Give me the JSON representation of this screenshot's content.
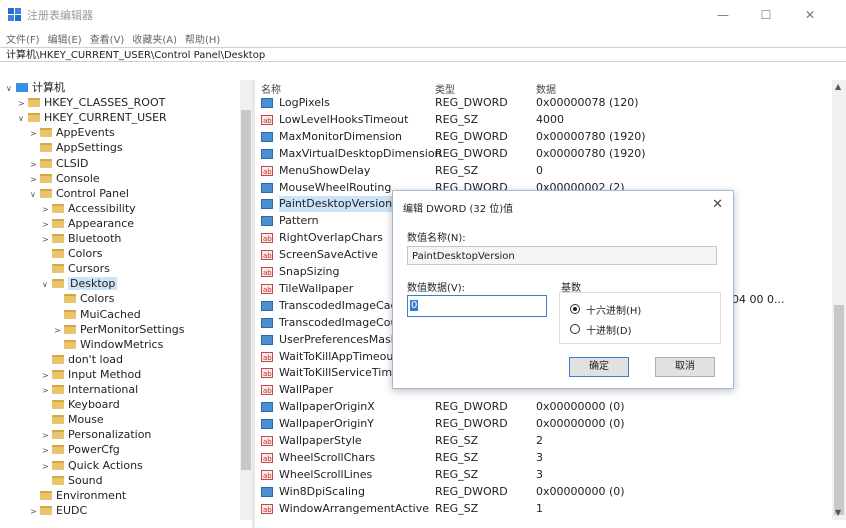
{
  "window": {
    "title": "注册表编辑器",
    "minimize": "—",
    "maximize": "☐",
    "close": "✕"
  },
  "menu": [
    "文件(F)",
    "编辑(E)",
    "查看(V)",
    "收藏夹(A)",
    "帮助(H)"
  ],
  "address": "计算机\\HKEY_CURRENT_USER\\Control Panel\\Desktop",
  "tree": [
    {
      "label": "计算机",
      "indent": 0,
      "chev": "∨",
      "icon": "pc"
    },
    {
      "label": "HKEY_CLASSES_ROOT",
      "indent": 1,
      "chev": ">"
    },
    {
      "label": "HKEY_CURRENT_USER",
      "indent": 1,
      "chev": "∨"
    },
    {
      "label": "AppEvents",
      "indent": 2,
      "chev": ">"
    },
    {
      "label": "AppSettings",
      "indent": 2,
      "chev": ""
    },
    {
      "label": "CLSID",
      "indent": 2,
      "chev": ">"
    },
    {
      "label": "Console",
      "indent": 2,
      "chev": ">"
    },
    {
      "label": "Control Panel",
      "indent": 2,
      "chev": "∨"
    },
    {
      "label": "Accessibility",
      "indent": 3,
      "chev": ">"
    },
    {
      "label": "Appearance",
      "indent": 3,
      "chev": ">"
    },
    {
      "label": "Bluetooth",
      "indent": 3,
      "chev": ">"
    },
    {
      "label": "Colors",
      "indent": 3,
      "chev": ""
    },
    {
      "label": "Cursors",
      "indent": 3,
      "chev": ""
    },
    {
      "label": "Desktop",
      "indent": 3,
      "chev": "∨",
      "selected": true
    },
    {
      "label": "Colors",
      "indent": 4,
      "chev": ""
    },
    {
      "label": "MuiCached",
      "indent": 4,
      "chev": ""
    },
    {
      "label": "PerMonitorSettings",
      "indent": 4,
      "chev": ">"
    },
    {
      "label": "WindowMetrics",
      "indent": 4,
      "chev": ""
    },
    {
      "label": "don't load",
      "indent": 3,
      "chev": ""
    },
    {
      "label": "Input Method",
      "indent": 3,
      "chev": ">"
    },
    {
      "label": "International",
      "indent": 3,
      "chev": ">"
    },
    {
      "label": "Keyboard",
      "indent": 3,
      "chev": ""
    },
    {
      "label": "Mouse",
      "indent": 3,
      "chev": ""
    },
    {
      "label": "Personalization",
      "indent": 3,
      "chev": ">"
    },
    {
      "label": "PowerCfg",
      "indent": 3,
      "chev": ">"
    },
    {
      "label": "Quick Actions",
      "indent": 3,
      "chev": ">"
    },
    {
      "label": "Sound",
      "indent": 3,
      "chev": ""
    },
    {
      "label": "Environment",
      "indent": 2,
      "chev": ""
    },
    {
      "label": "EUDC",
      "indent": 2,
      "chev": ">"
    }
  ],
  "columns": {
    "name": "名称",
    "type": "类型",
    "data": "数据"
  },
  "rows": [
    {
      "name": "LogPixels",
      "type": "REG_DWORD",
      "data": "0x00000078 (120)",
      "kind": "bin"
    },
    {
      "name": "LowLevelHooksTimeout",
      "type": "REG_SZ",
      "data": "4000",
      "kind": "str"
    },
    {
      "name": "MaxMonitorDimension",
      "type": "REG_DWORD",
      "data": "0x00000780 (1920)",
      "kind": "bin"
    },
    {
      "name": "MaxVirtualDesktopDimension",
      "type": "REG_DWORD",
      "data": "0x00000780 (1920)",
      "kind": "bin"
    },
    {
      "name": "MenuShowDelay",
      "type": "REG_SZ",
      "data": "0",
      "kind": "str"
    },
    {
      "name": "MouseWheelRouting",
      "type": "REG_DWORD",
      "data": "0x00000002 (2)",
      "kind": "bin"
    },
    {
      "name": "PaintDesktopVersion",
      "type": "",
      "data": "",
      "kind": "bin",
      "selected": true
    },
    {
      "name": "Pattern",
      "type": "",
      "data": "",
      "kind": "bin"
    },
    {
      "name": "RightOverlapChars",
      "type": "",
      "data": "",
      "kind": "str"
    },
    {
      "name": "ScreenSaveActive",
      "type": "",
      "data": "",
      "kind": "str"
    },
    {
      "name": "SnapSizing",
      "type": "",
      "data": "",
      "kind": "str"
    },
    {
      "name": "TileWallpaper",
      "type": "",
      "data": "",
      "kind": "str"
    },
    {
      "name": "TranscodedImageCache",
      "type": "",
      "data": "",
      "kind": "bin"
    },
    {
      "name": "TranscodedImageCount",
      "type": "",
      "data": "",
      "kind": "bin"
    },
    {
      "name": "UserPreferencesMask",
      "type": "",
      "data": "",
      "kind": "bin"
    },
    {
      "name": "WaitToKillAppTimeout",
      "type": "",
      "data": "",
      "kind": "str"
    },
    {
      "name": "WaitToKillServiceTimeo",
      "type": "",
      "data": "",
      "kind": "str"
    },
    {
      "name": "WallPaper",
      "type": "",
      "data": "",
      "kind": "str"
    },
    {
      "name": "WallpaperOriginX",
      "type": "REG_DWORD",
      "data": "0x00000000 (0)",
      "kind": "bin"
    },
    {
      "name": "WallpaperOriginY",
      "type": "REG_DWORD",
      "data": "0x00000000 (0)",
      "kind": "bin"
    },
    {
      "name": "WallpaperStyle",
      "type": "REG_SZ",
      "data": "2",
      "kind": "str"
    },
    {
      "name": "WheelScrollChars",
      "type": "REG_SZ",
      "data": "3",
      "kind": "str"
    },
    {
      "name": "WheelScrollLines",
      "type": "REG_SZ",
      "data": "3",
      "kind": "str"
    },
    {
      "name": "Win8DpiScaling",
      "type": "REG_DWORD",
      "data": "0x00000000 (0)",
      "kind": "bin"
    },
    {
      "name": "WindowArrangementActive",
      "type": "REG_SZ",
      "data": "1",
      "kind": "str"
    }
  ],
  "truncated_value": "04 00 0...",
  "dialog": {
    "title": "编辑 DWORD (32 位)值",
    "close": "✕",
    "name_label": "数值名称(N):",
    "name_value": "PaintDesktopVersion",
    "data_label": "数值数据(V):",
    "data_value": "0",
    "base_label": "基数",
    "hex_label": "十六进制(H)",
    "dec_label": "十进制(D)",
    "ok": "确定",
    "cancel": "取消"
  }
}
